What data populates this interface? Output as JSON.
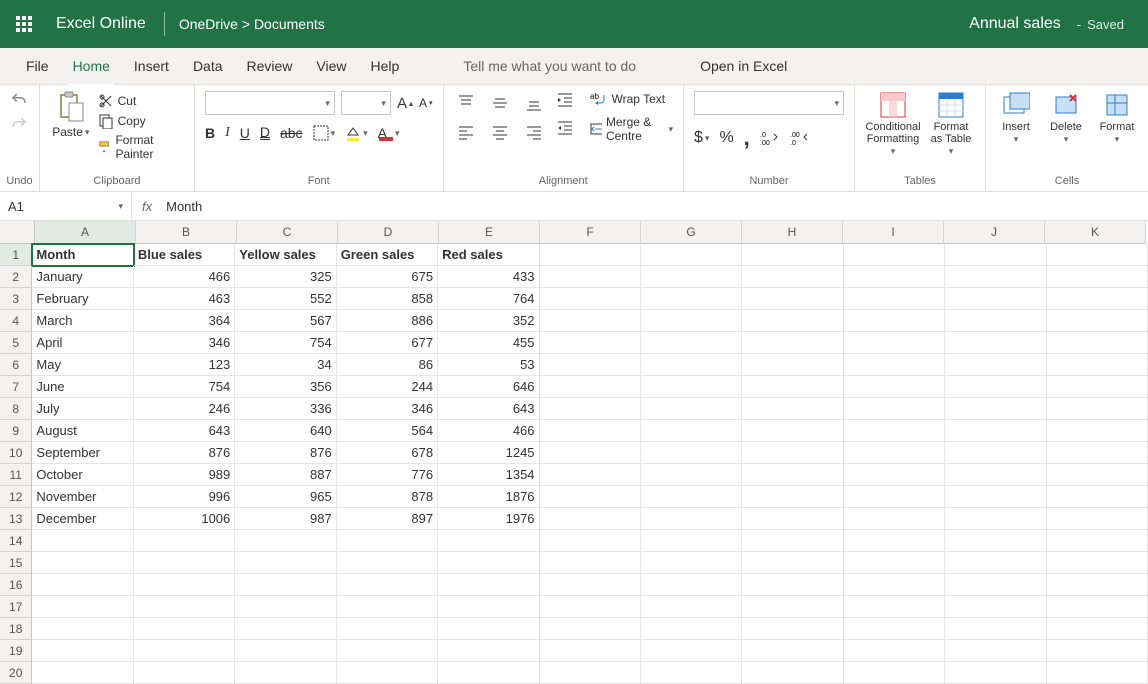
{
  "header": {
    "brand": "Excel Online",
    "path_parent": "OneDrive",
    "path_sep": " > ",
    "path_leaf": "Documents",
    "doc_title": "Annual sales",
    "save_dash": "-",
    "save_status": "Saved"
  },
  "tabs": {
    "file": "File",
    "home": "Home",
    "insert": "Insert",
    "data": "Data",
    "review": "Review",
    "view": "View",
    "help": "Help",
    "search_hint": "Tell me what you want to do",
    "open_excel": "Open in Excel"
  },
  "ribbon": {
    "undo_group": "Undo",
    "clipboard": {
      "paste": "Paste",
      "cut": "Cut",
      "copy": "Copy",
      "format_painter": "Format Painter",
      "label": "Clipboard"
    },
    "font": {
      "label": "Font",
      "bold": "B",
      "italic": "I",
      "underline": "U",
      "dbl": "D",
      "strike": "abc",
      "grow": "A↑",
      "shrink": "A↓"
    },
    "alignment": {
      "label": "Alignment",
      "wrap": "Wrap Text",
      "merge": "Merge & Centre"
    },
    "number": {
      "label": "Number",
      "dollar": "$",
      "percent": "%",
      "comma": ",",
      "inc": ".00→.0",
      "dec": ".0→.00"
    },
    "tables": {
      "label": "Tables",
      "cond": "Conditional",
      "cond2": "Formatting",
      "asTable": "Format",
      "asTable2": "as Table"
    },
    "cells": {
      "label": "Cells",
      "insert": "Insert",
      "delete": "Delete",
      "format": "Format"
    }
  },
  "formula_bar": {
    "cell_ref": "A1",
    "fx": "fx",
    "formula": "Month"
  },
  "columns": [
    "A",
    "B",
    "C",
    "D",
    "E",
    "F",
    "G",
    "H",
    "I",
    "J",
    "K"
  ],
  "row_count": 20,
  "sheet": {
    "headers": [
      "Month",
      "Blue sales",
      "Yellow sales",
      "Green sales",
      "Red sales"
    ],
    "rows": [
      [
        "January",
        466,
        325,
        675,
        433
      ],
      [
        "February",
        463,
        552,
        858,
        764
      ],
      [
        "March",
        364,
        567,
        886,
        352
      ],
      [
        "April",
        346,
        754,
        677,
        455
      ],
      [
        "May",
        123,
        34,
        86,
        53
      ],
      [
        "June",
        754,
        356,
        244,
        646
      ],
      [
        "July",
        246,
        336,
        346,
        643
      ],
      [
        "August",
        643,
        640,
        564,
        466
      ],
      [
        "September",
        876,
        876,
        678,
        1245
      ],
      [
        "October",
        989,
        887,
        776,
        1354
      ],
      [
        "November",
        996,
        965,
        878,
        1876
      ],
      [
        "December",
        1006,
        987,
        897,
        1976
      ]
    ]
  },
  "active_cell": {
    "row": 1,
    "col": "A"
  }
}
